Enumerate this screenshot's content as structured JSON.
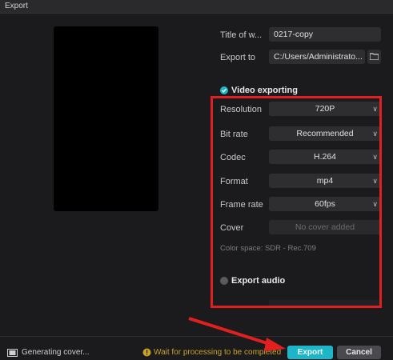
{
  "window": {
    "title": "Export"
  },
  "fields": {
    "title": {
      "label": "Title of w...",
      "value": "0217-copy"
    },
    "export_to": {
      "label": "Export to",
      "value": "C:/Users/Administrato..."
    }
  },
  "video": {
    "section_label": "Video exporting",
    "checked": true,
    "resolution": {
      "label": "Resolution",
      "value": "720P"
    },
    "bit_rate": {
      "label": "Bit rate",
      "value": "Recommended"
    },
    "codec": {
      "label": "Codec",
      "value": "H.264"
    },
    "format": {
      "label": "Format",
      "value": "mp4"
    },
    "frame_rate": {
      "label": "Frame rate",
      "value": "60fps"
    },
    "cover": {
      "label": "Cover",
      "value": "No cover added"
    },
    "color_space": "Color space: SDR - Rec.709"
  },
  "audio": {
    "section_label": "Export audio",
    "checked": false
  },
  "status": {
    "generating": "Generating cover...",
    "warning": "Wait for processing to be completed"
  },
  "buttons": {
    "export": "Export",
    "cancel": "Cancel"
  },
  "colors": {
    "accent": "#1fb5c9",
    "warning": "#c9a227",
    "annotation": "#e02020"
  }
}
